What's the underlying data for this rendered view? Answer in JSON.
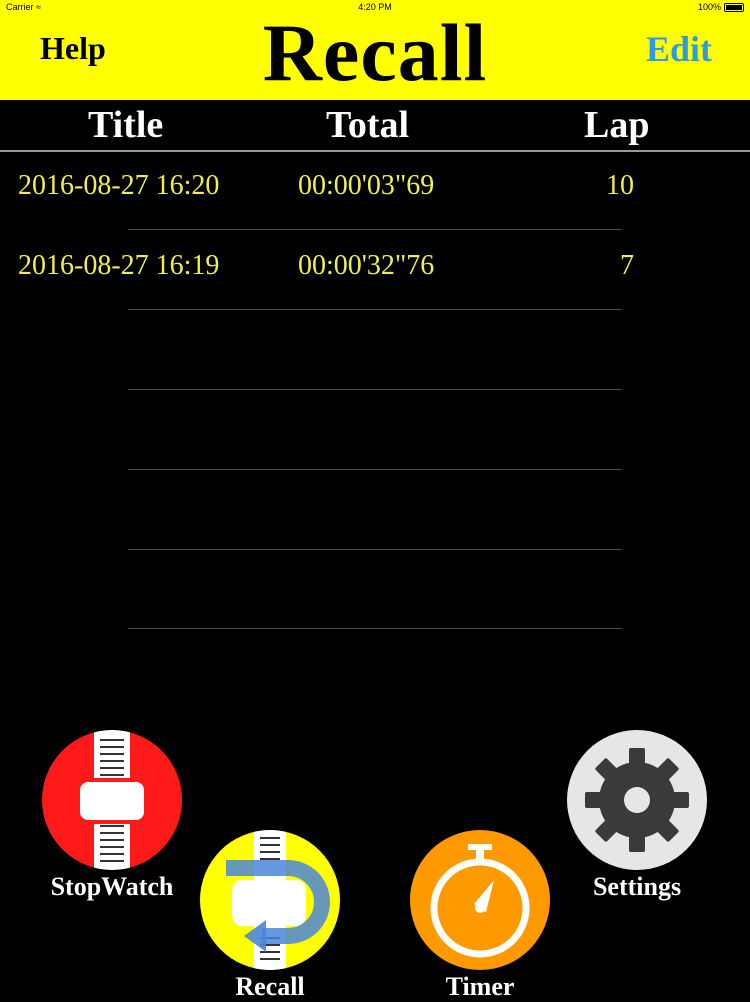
{
  "status_bar": {
    "carrier": "Carrier",
    "time": "4:20 PM",
    "battery": "100%"
  },
  "header": {
    "left_button": "Help",
    "title": "Recall",
    "right_button": "Edit"
  },
  "columns": [
    "Title",
    "Total",
    "Lap"
  ],
  "rows": [
    {
      "title": "2016-08-27 16:20",
      "total": "00:00'03\"69",
      "lap": "10"
    },
    {
      "title": "2016-08-27 16:19",
      "total": "00:00'32\"76",
      "lap": "7"
    }
  ],
  "nav": [
    {
      "label": "StopWatch",
      "icon": "stopwatch-strap-icon",
      "color": "#ff1a1a"
    },
    {
      "label": "Recall",
      "icon": "recall-icon",
      "color": "#ffff00"
    },
    {
      "label": "Timer",
      "icon": "timer-icon",
      "color": "#ff9900"
    },
    {
      "label": "Settings",
      "icon": "gear-icon",
      "color": "#e6e6e6"
    }
  ],
  "colors": {
    "header_bg": "#ffff00",
    "row_text": "#f2ee4a",
    "edit": "#2b9be8"
  }
}
